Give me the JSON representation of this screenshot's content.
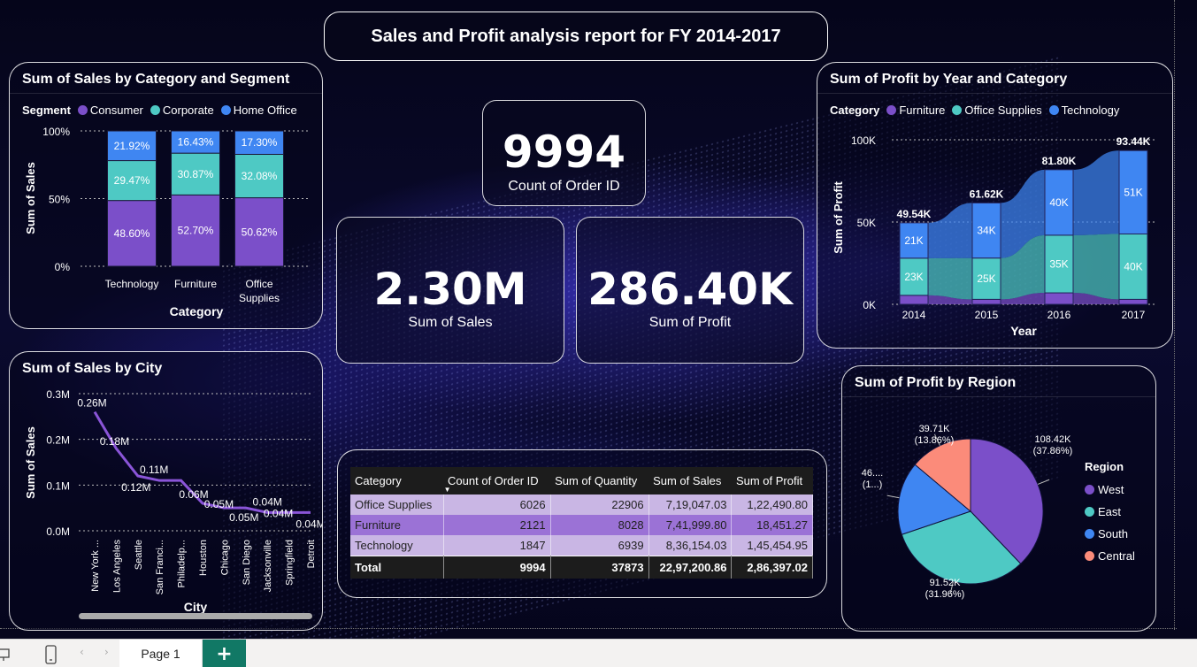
{
  "report_title": "Sales and Profit analysis report for FY 2014-2017",
  "colors": {
    "consumer": "#7b4fc9",
    "corporate": "#4ec9c4",
    "home_office": "#3f86f2",
    "furniture": "#7b4fc9",
    "office_supplies": "#4ec9c4",
    "technology": "#3f86f2",
    "west": "#7b4fc9",
    "east": "#4ec9c4",
    "south": "#3f86f2",
    "central": "#fb8b7a"
  },
  "kpis": {
    "orders": {
      "value": "9994",
      "label": "Count of Order ID"
    },
    "sales": {
      "value": "2.30M",
      "label": "Sum of Sales"
    },
    "profit": {
      "value": "286.40K",
      "label": "Sum of Profit"
    }
  },
  "sales_cat_seg": {
    "title": "Sum of Sales by Category and Segment",
    "legend_title": "Segment",
    "legend": [
      "Consumer",
      "Corporate",
      "Home Office"
    ],
    "y_ticks": [
      "100%",
      "50%",
      "0%"
    ],
    "ylabel": "Sum of Sales",
    "xlabel": "Category",
    "categories": [
      "Technology",
      "Furniture",
      "Office Supplies"
    ],
    "labels": {
      "consumer": [
        "48.60%",
        "52.70%",
        "50.62%"
      ],
      "corporate": [
        "29.47%",
        "30.87%",
        "32.08%"
      ],
      "home_office": [
        "21.92%",
        "16.43%",
        "17.30%"
      ]
    }
  },
  "profit_year_cat": {
    "title": "Sum of Profit by Year and Category",
    "legend_title": "Category",
    "legend": [
      "Furniture",
      "Office Supplies",
      "Technology"
    ],
    "y_ticks": [
      "100K",
      "50K",
      "0K"
    ],
    "ylabel": "Sum of Profit",
    "xlabel": "Year",
    "years": [
      "2014",
      "2015",
      "2016",
      "2017"
    ],
    "totals": [
      "49.54K",
      "61.62K",
      "81.80K",
      "93.44K"
    ],
    "office_labels": [
      "23K",
      "25K",
      "35K",
      "40K"
    ],
    "tech_labels": [
      "21K",
      "34K",
      "40K",
      "51K"
    ]
  },
  "sales_city": {
    "title": "Sum of Sales by City",
    "ylabel": "Sum of Sales",
    "xlabel": "City",
    "y_ticks": [
      "0.3M",
      "0.2M",
      "0.1M",
      "0.0M"
    ],
    "cities": [
      "New York ...",
      "Los Angeles",
      "Seattle",
      "San Franci...",
      "Philadelp...",
      "Houston",
      "Chicago",
      "San Diego",
      "Jacksonville",
      "Springfield",
      "Detroit"
    ],
    "point_labels": [
      "0.26M",
      "0.18M",
      "0.12M",
      "0.11M",
      "",
      "0.06M",
      "0.05M",
      "0.05M",
      "0.04M",
      "0.04M",
      "0.04M"
    ],
    "scroll_label": "0"
  },
  "profit_region": {
    "title": "Sum of Profit by Region",
    "legend_title": "Region",
    "legend": [
      "West",
      "East",
      "South",
      "Central"
    ],
    "labels": {
      "west": [
        "108.42K",
        "(37.86%)"
      ],
      "east": [
        "91.52K",
        "(31.96%)"
      ],
      "south": [
        "46....",
        "(1...)"
      ],
      "central": [
        "39.71K",
        "(13.86%)"
      ]
    }
  },
  "chart_data": [
    {
      "type": "bar",
      "title": "Sum of Sales by Category and Segment",
      "xlabel": "Category",
      "ylabel": "Sum of Sales",
      "categories": [
        "Technology",
        "Furniture",
        "Office Supplies"
      ],
      "series": [
        {
          "name": "Consumer",
          "values": [
            48.6,
            52.7,
            50.62
          ]
        },
        {
          "name": "Corporate",
          "values": [
            29.47,
            30.87,
            32.08
          ]
        },
        {
          "name": "Home Office",
          "values": [
            21.92,
            16.43,
            17.3
          ]
        }
      ],
      "ylim": [
        0,
        100
      ],
      "stacked": "100%",
      "legend": "top",
      "grid": true
    },
    {
      "type": "area",
      "title": "Sum of Profit by Year and Category",
      "xlabel": "Year",
      "ylabel": "Sum of Profit",
      "categories": [
        "2014",
        "2015",
        "2016",
        "2017"
      ],
      "series": [
        {
          "name": "Furniture",
          "values": [
            5.46,
            3.02,
            6.96,
            3.02
          ]
        },
        {
          "name": "Office Supplies",
          "values": [
            22.59,
            25.1,
            35.06,
            39.74
          ]
        },
        {
          "name": "Technology",
          "values": [
            21.49,
            33.5,
            39.78,
            50.68
          ]
        }
      ],
      "totals": [
        49.54,
        61.62,
        81.8,
        93.44
      ],
      "ylim": [
        0,
        100
      ],
      "units": "K",
      "legend": "top",
      "grid": true
    },
    {
      "type": "line",
      "title": "Sum of Sales by City",
      "xlabel": "City",
      "ylabel": "Sum of Sales",
      "categories": [
        "New York ...",
        "Los Angeles",
        "Seattle",
        "San Franci...",
        "Philadelp...",
        "Houston",
        "Chicago",
        "San Diego",
        "Jacksonville",
        "Springfield",
        "Detroit"
      ],
      "values": [
        0.26,
        0.18,
        0.12,
        0.11,
        0.11,
        0.06,
        0.05,
        0.05,
        0.04,
        0.04,
        0.04
      ],
      "ylim": [
        0,
        0.3
      ],
      "units": "M",
      "grid": true
    },
    {
      "type": "pie",
      "title": "Sum of Profit by Region",
      "categories": [
        "West",
        "East",
        "South",
        "Central"
      ],
      "values": [
        108.42,
        91.52,
        46.75,
        39.71
      ],
      "percent": [
        37.86,
        31.96,
        16.32,
        13.86
      ],
      "units": "K",
      "legend": "right"
    },
    {
      "type": "table",
      "columns": [
        "Category",
        "Count of Order ID",
        "Sum of Quantity",
        "Sum of Sales",
        "Sum of Profit"
      ],
      "rows": [
        [
          "Office Supplies",
          "6026",
          "22906",
          "7,19,047.03",
          "1,22,490.80"
        ],
        [
          "Furniture",
          "2121",
          "8028",
          "7,41,999.80",
          "18,451.27"
        ],
        [
          "Technology",
          "1847",
          "6939",
          "8,36,154.03",
          "1,45,454.95"
        ]
      ],
      "total": [
        "Total",
        "9994",
        "37873",
        "22,97,200.86",
        "2,86,397.02"
      ]
    }
  ],
  "status": {
    "page_tab": "Page 1",
    "add_tab": "+"
  }
}
